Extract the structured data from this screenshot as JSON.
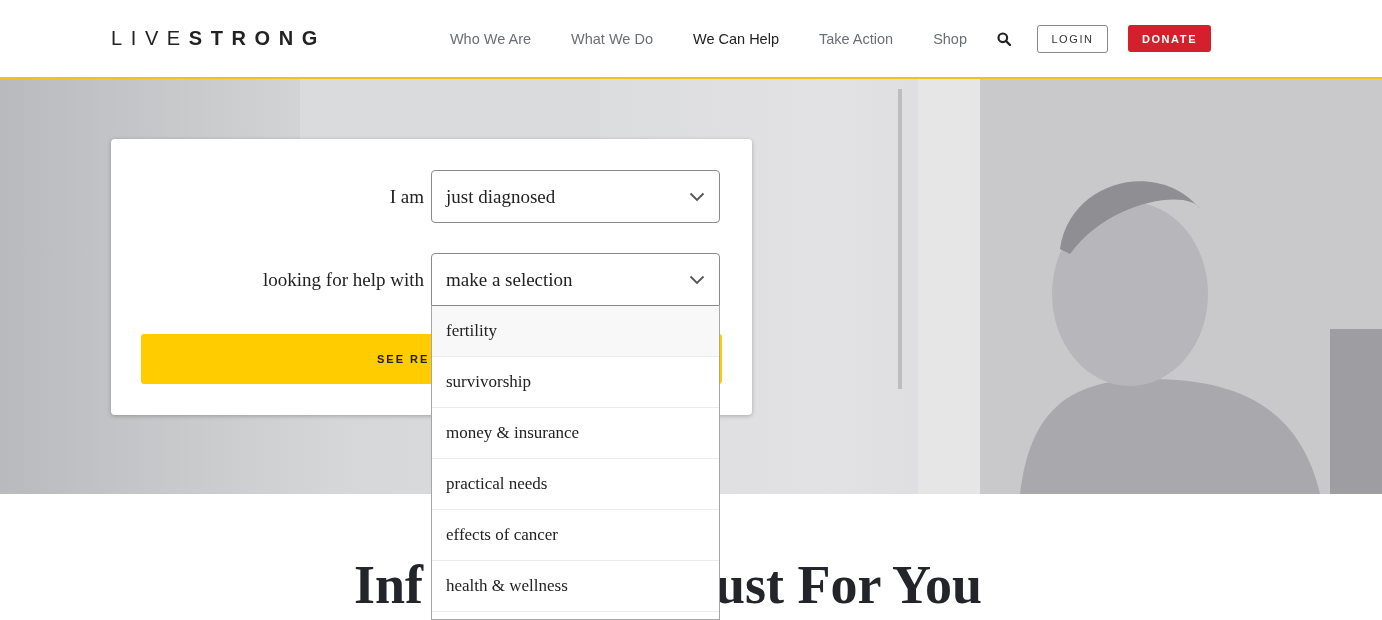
{
  "header": {
    "logo": {
      "light": "LIVE",
      "bold": "STRONG"
    },
    "nav": [
      {
        "label": "Who We Are",
        "selected": false
      },
      {
        "label": "What We Do",
        "selected": false
      },
      {
        "label": "We Can Help",
        "selected": true
      },
      {
        "label": "Take Action",
        "selected": false
      },
      {
        "label": "Shop",
        "selected": false
      }
    ],
    "login": "LOGIN",
    "donate": "DONATE"
  },
  "hero": {
    "form": {
      "fields": [
        {
          "label": "I am",
          "value": "just diagnosed",
          "expanded": false
        },
        {
          "label": "looking for help with",
          "value": "make a selection",
          "expanded": true,
          "options": [
            {
              "label": "fertility",
              "selected": true
            },
            {
              "label": "survivorship",
              "selected": false
            },
            {
              "label": "money & insurance",
              "selected": false
            },
            {
              "label": "practical needs",
              "selected": false
            },
            {
              "label": "effects of cancer",
              "selected": false
            },
            {
              "label": "health & wellness",
              "selected": false
            }
          ]
        }
      ],
      "submit": "SEE RE"
    }
  },
  "heading": {
    "parts": [
      "Inf",
      "ust For You"
    ]
  }
}
